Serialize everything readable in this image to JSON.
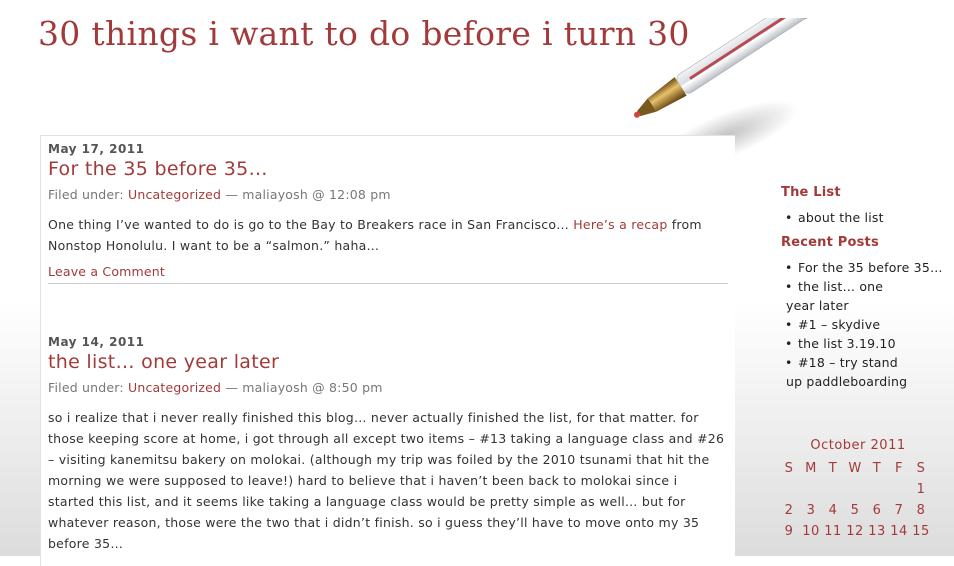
{
  "site": {
    "title": "30 things i want to do before i turn 30"
  },
  "posts": [
    {
      "date": "May 17, 2011",
      "title": "For the 35 before 35…",
      "filed_label": "Filed under:",
      "category": "Uncategorized",
      "byline": "— maliayosh @ 12:08 pm",
      "body_before": "One thing I’ve wanted to do is go to the Bay to Breakers race in San Francisco… ",
      "body_link": "Here’s a recap",
      "body_after": " from Nonstop Honolulu. I want to be a “salmon.” haha…",
      "comment_link": "Leave a Comment"
    },
    {
      "date": "May 14, 2011",
      "title": "the list… one year later",
      "filed_label": "Filed under:",
      "category": "Uncategorized",
      "byline": "— maliayosh @ 8:50 pm",
      "body": "so i realize that i never really finished this blog… never actually finished the list, for that matter. for those keeping score at home, i got through all except two items – #13 taking a language class and #26 – visiting kanemitsu bakery on molokai. (although my trip was foiled by the 2010 tsunami that hit the morning we were supposed to leave!) hard to believe that i haven’t been back to molokai since i started this list, and it seems like taking a language class would be pretty simple as well… but for whatever reason, those were the two that i didn’t finish. so i guess they’ll have to move onto my 35 before 35…"
    }
  ],
  "sidebar": {
    "the_list_heading": "The List",
    "the_list_items": [
      "about the list"
    ],
    "recent_heading": "Recent Posts",
    "recent_items": [
      {
        "line1": "For the 35 before 35…",
        "line2": ""
      },
      {
        "line1": "the list… one",
        "line2": "year later"
      },
      {
        "line1": "#1 – skydive",
        "line2": ""
      },
      {
        "line1": "the list 3.19.10",
        "line2": ""
      },
      {
        "line1": "#18 – try stand",
        "line2": "up paddleboarding"
      }
    ]
  },
  "calendar": {
    "caption": "October 2011",
    "weekdays": [
      "S",
      "M",
      "T",
      "W",
      "T",
      "F",
      "S"
    ],
    "weeks": [
      [
        "",
        "",
        "",
        "",
        "",
        "",
        "1"
      ],
      [
        "2",
        "3",
        "4",
        "5",
        "6",
        "7",
        "8"
      ],
      [
        "9",
        "10",
        "11",
        "12",
        "13",
        "14",
        "15"
      ]
    ]
  },
  "colors": {
    "accent": "#a33a3a",
    "text": "#333333",
    "meta": "#777777"
  },
  "icons": {
    "header_image": "ballpoint-pen-image",
    "list_bullet": "bullet"
  }
}
